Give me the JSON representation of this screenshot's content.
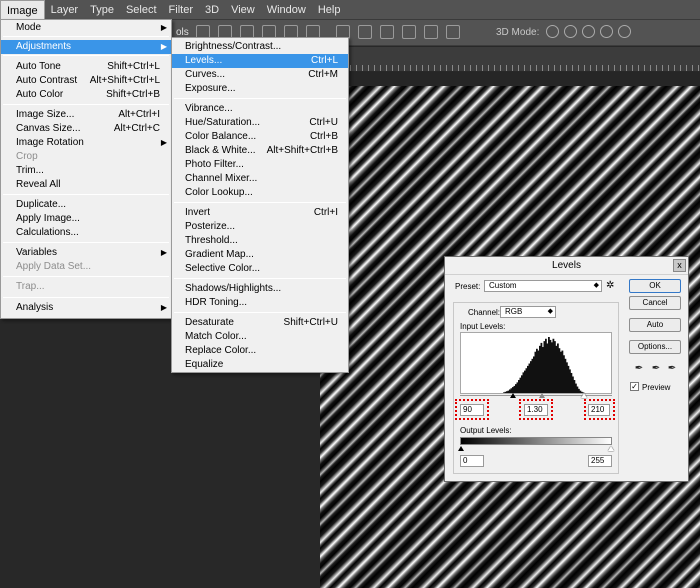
{
  "menubar": {
    "items": [
      "Image",
      "Layer",
      "Type",
      "Select",
      "Filter",
      "3D",
      "View",
      "Window",
      "Help"
    ],
    "active_item": "Image"
  },
  "optionsbar": {
    "fragment": "ols",
    "mode_label": "3D Mode:"
  },
  "image_menu": {
    "items": [
      {
        "label": "Mode",
        "shortcut": "",
        "submenu": true,
        "disabled": false
      },
      {
        "label": "Adjustments",
        "shortcut": "",
        "submenu": true,
        "disabled": false,
        "selected": true
      },
      {
        "label": "Auto Tone",
        "shortcut": "Shift+Ctrl+L",
        "disabled": false
      },
      {
        "label": "Auto Contrast",
        "shortcut": "Alt+Shift+Ctrl+L",
        "disabled": false
      },
      {
        "label": "Auto Color",
        "shortcut": "Shift+Ctrl+B",
        "disabled": false
      },
      {
        "label": "Image Size...",
        "shortcut": "Alt+Ctrl+I",
        "disabled": false
      },
      {
        "label": "Canvas Size...",
        "shortcut": "Alt+Ctrl+C",
        "disabled": false
      },
      {
        "label": "Image Rotation",
        "shortcut": "",
        "submenu": true,
        "disabled": false
      },
      {
        "label": "Crop",
        "shortcut": "",
        "disabled": true
      },
      {
        "label": "Trim...",
        "shortcut": "",
        "disabled": false
      },
      {
        "label": "Reveal All",
        "shortcut": "",
        "disabled": false
      },
      {
        "label": "Duplicate...",
        "shortcut": "",
        "disabled": false
      },
      {
        "label": "Apply Image...",
        "shortcut": "",
        "disabled": false
      },
      {
        "label": "Calculations...",
        "shortcut": "",
        "disabled": false
      },
      {
        "label": "Variables",
        "shortcut": "",
        "submenu": true,
        "disabled": false
      },
      {
        "label": "Apply Data Set...",
        "shortcut": "",
        "disabled": true
      },
      {
        "label": "Trap...",
        "shortcut": "",
        "disabled": true
      },
      {
        "label": "Analysis",
        "shortcut": "",
        "submenu": true,
        "disabled": false
      }
    ]
  },
  "adjustments_menu": {
    "items": [
      {
        "label": "Brightness/Contrast...",
        "shortcut": ""
      },
      {
        "label": "Levels...",
        "shortcut": "Ctrl+L",
        "selected": true
      },
      {
        "label": "Curves...",
        "shortcut": "Ctrl+M"
      },
      {
        "label": "Exposure...",
        "shortcut": ""
      },
      {
        "label": "Vibrance...",
        "shortcut": ""
      },
      {
        "label": "Hue/Saturation...",
        "shortcut": "Ctrl+U"
      },
      {
        "label": "Color Balance...",
        "shortcut": "Ctrl+B"
      },
      {
        "label": "Black & White...",
        "shortcut": "Alt+Shift+Ctrl+B"
      },
      {
        "label": "Photo Filter...",
        "shortcut": ""
      },
      {
        "label": "Channel Mixer...",
        "shortcut": ""
      },
      {
        "label": "Color Lookup...",
        "shortcut": ""
      },
      {
        "label": "Invert",
        "shortcut": "Ctrl+I"
      },
      {
        "label": "Posterize...",
        "shortcut": ""
      },
      {
        "label": "Threshold...",
        "shortcut": ""
      },
      {
        "label": "Gradient Map...",
        "shortcut": ""
      },
      {
        "label": "Selective Color...",
        "shortcut": ""
      },
      {
        "label": "Shadows/Highlights...",
        "shortcut": ""
      },
      {
        "label": "HDR Toning...",
        "shortcut": ""
      },
      {
        "label": "Desaturate",
        "shortcut": "Shift+Ctrl+U"
      },
      {
        "label": "Match Color...",
        "shortcut": ""
      },
      {
        "label": "Replace Color...",
        "shortcut": ""
      },
      {
        "label": "Equalize",
        "shortcut": ""
      }
    ]
  },
  "levels_dialog": {
    "title": "Levels",
    "preset_label": "Preset:",
    "preset_value": "Custom",
    "channel_label": "Channel:",
    "channel_value": "RGB",
    "input_levels_label": "Input Levels:",
    "input_black": "90",
    "input_gamma": "1.30",
    "input_white": "210",
    "output_levels_label": "Output Levels:",
    "output_black": "0",
    "output_white": "255",
    "ok_label": "OK",
    "cancel_label": "Cancel",
    "auto_label": "Auto",
    "options_label": "Options...",
    "preview_label": "Preview",
    "preview_checked": true,
    "close_glyph": "x",
    "check_glyph": "✓",
    "histogram": [
      0,
      0,
      0,
      0,
      0,
      0,
      0,
      0,
      0,
      0,
      0,
      0,
      0,
      0,
      0,
      0,
      0,
      0,
      0,
      0,
      0,
      0,
      0,
      0,
      0,
      0,
      0,
      0,
      1,
      2,
      3,
      4,
      6,
      8,
      10,
      12,
      15,
      18,
      22,
      26,
      30,
      35,
      38,
      42,
      46,
      50,
      54,
      58,
      62,
      70,
      75,
      72,
      80,
      85,
      78,
      88,
      92,
      84,
      95,
      90,
      86,
      92,
      88,
      80,
      84,
      76,
      70,
      72,
      64,
      58,
      52,
      46,
      40,
      34,
      28,
      22,
      16,
      11,
      7,
      4,
      2,
      1,
      0,
      0,
      0,
      0,
      0,
      0,
      0,
      0,
      0,
      0,
      0,
      0,
      0,
      0,
      0,
      0,
      0,
      0
    ]
  }
}
